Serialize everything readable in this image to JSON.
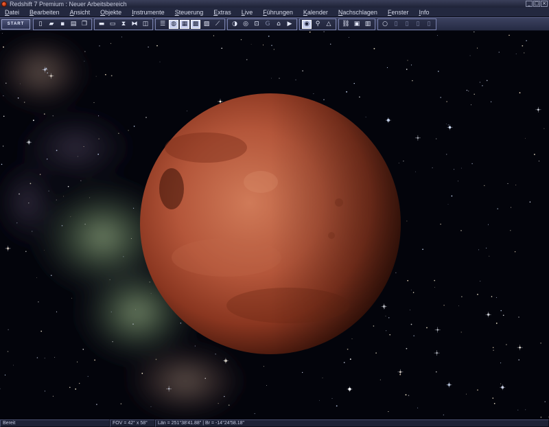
{
  "window": {
    "title": "Redshift 7 Premium : Neuer Arbeitsbereich",
    "buttons": [
      "_",
      "□",
      "×"
    ]
  },
  "menu": [
    "Datei",
    "Bearbeiten",
    "Ansicht",
    "Objekte",
    "Instrumente",
    "Steuerung",
    "Extras",
    "Live",
    "Führungen",
    "Kalender",
    "Nachschlagen",
    "Fenster",
    "Info"
  ],
  "toolbar": {
    "start_label": "START",
    "groups": [
      {
        "name": "file",
        "buttons": [
          {
            "icon": "new-document-icon",
            "glyph": "▯"
          },
          {
            "icon": "open-folder-icon",
            "glyph": "▰"
          },
          {
            "icon": "save-icon",
            "glyph": "▪"
          },
          {
            "icon": "print-icon",
            "glyph": "▤"
          },
          {
            "icon": "copy-icon",
            "glyph": "❐"
          }
        ]
      },
      {
        "name": "view",
        "buttons": [
          {
            "icon": "monitor-icon",
            "glyph": "▬"
          },
          {
            "icon": "window-icon",
            "glyph": "▭"
          },
          {
            "icon": "hourglass-icon",
            "glyph": "⧗"
          },
          {
            "icon": "play-back-forth-icon",
            "glyph": "⧓"
          },
          {
            "icon": "frame-icon",
            "glyph": "◫"
          }
        ]
      },
      {
        "name": "display",
        "buttons": [
          {
            "icon": "list-icon",
            "glyph": "☰"
          },
          {
            "icon": "globe-icon",
            "glyph": "◍",
            "active": true
          },
          {
            "icon": "chart-icon",
            "glyph": "▦",
            "active": true
          },
          {
            "icon": "grid-icon",
            "glyph": "▩",
            "active": true
          },
          {
            "icon": "image-icon",
            "glyph": "▨"
          },
          {
            "icon": "telescope-icon",
            "glyph": "⟋"
          }
        ]
      },
      {
        "name": "navigation",
        "buttons": [
          {
            "icon": "compass-icon",
            "glyph": "◑"
          },
          {
            "icon": "orbit-icon",
            "glyph": "◎"
          },
          {
            "icon": "target-icon",
            "glyph": "⊡"
          },
          {
            "icon": "g-letter-icon",
            "glyph": "G",
            "dim": true
          },
          {
            "icon": "home-icon",
            "glyph": "⌂"
          },
          {
            "icon": "play-icon",
            "glyph": "▶"
          }
        ]
      },
      {
        "name": "tools",
        "buttons": [
          {
            "icon": "camera-view-icon",
            "glyph": "◉",
            "active": true
          },
          {
            "icon": "zoom-icon",
            "glyph": "⚲"
          },
          {
            "icon": "triangle-icon",
            "glyph": "△"
          }
        ]
      },
      {
        "name": "extras",
        "buttons": [
          {
            "icon": "link-icon",
            "glyph": "⛓"
          },
          {
            "icon": "photo-icon",
            "glyph": "▣"
          },
          {
            "icon": "screen-icon",
            "glyph": "▥"
          }
        ]
      },
      {
        "name": "info",
        "buttons": [
          {
            "icon": "circle-icon",
            "glyph": "○"
          },
          {
            "icon": "note-icon",
            "glyph": "▯",
            "dim": true
          },
          {
            "icon": "dialog-icon",
            "glyph": "▯",
            "dim": true
          },
          {
            "icon": "card-icon",
            "glyph": "▯",
            "dim": true
          },
          {
            "icon": "page-icon",
            "glyph": "▯",
            "dim": true
          }
        ]
      }
    ]
  },
  "status": {
    "ready": "Bereit",
    "fov": "FOV = 42° x 58°",
    "position": "Län = 251°38'41.88\" | Br = -14°24'58.18\""
  },
  "colors": {
    "chrome": "#23283f",
    "planet_light": "#c56a4b",
    "planet_dark": "#3a1208",
    "nebula": "#5f7a5a"
  }
}
